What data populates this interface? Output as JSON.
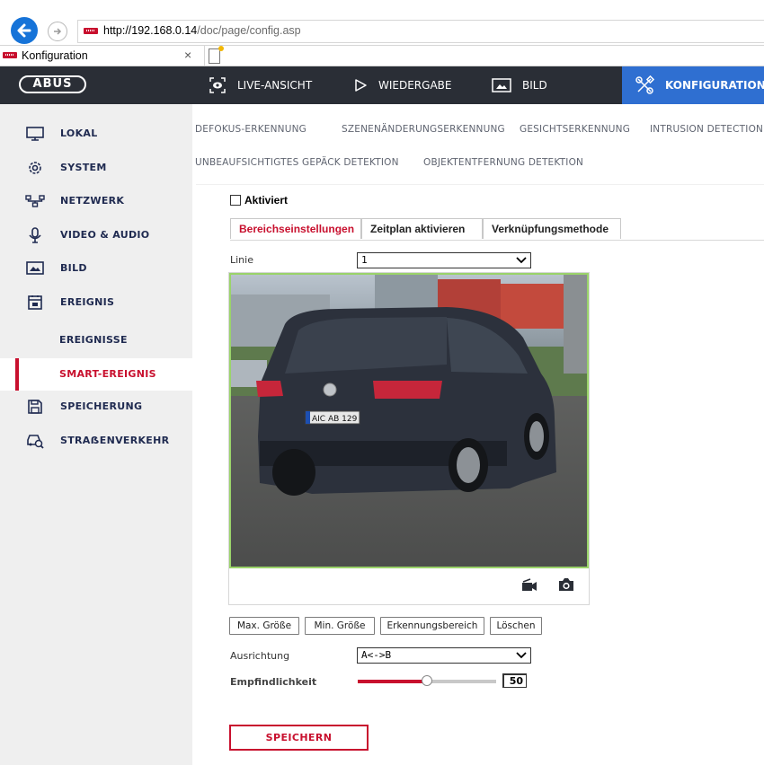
{
  "browser": {
    "url_host": "http://192.168.0.14",
    "url_path": "/doc/page/config.asp",
    "tab_title": "Konfiguration",
    "tab_close": "×"
  },
  "header": {
    "logo": "ABUS",
    "nav": [
      {
        "label": "LIVE-ANSICHT",
        "icon": "eye-camera-icon"
      },
      {
        "label": "WIEDERGABE",
        "icon": "play-icon"
      },
      {
        "label": "BILD",
        "icon": "image-icon"
      },
      {
        "label": "KONFIGURATION",
        "icon": "tools-icon",
        "active": true
      }
    ]
  },
  "sidebar": {
    "items": [
      {
        "label": "LOKAL",
        "icon": "monitor-icon"
      },
      {
        "label": "SYSTEM",
        "icon": "gear-icon"
      },
      {
        "label": "NETZWERK",
        "icon": "network-icon"
      },
      {
        "label": "VIDEO & AUDIO",
        "icon": "microphone-icon"
      },
      {
        "label": "BILD",
        "icon": "image-icon"
      },
      {
        "label": "EREIGNIS",
        "icon": "calendar-icon"
      },
      {
        "label": "EREIGNISSE",
        "sub": true
      },
      {
        "label": "SMART-EREIGNIS",
        "sub": true,
        "active": true
      },
      {
        "label": "SPEICHERUNG",
        "icon": "floppy-icon"
      },
      {
        "label": "STRAẞENVERKEHR",
        "icon": "car-search-icon"
      }
    ]
  },
  "subtabs": {
    "row1": [
      "DEFOKUS-ERKENNUNG",
      "SZENENÄNDERUNGSERKENNUNG",
      "GESICHTSERKENNUNG",
      "INTRUSION DETECTION"
    ],
    "row2": [
      "UNBEAUFSICHTIGTES GEPÄCK DETEKTION",
      "OBJEKTENTFERNUNG DETEKTION"
    ]
  },
  "form": {
    "enabled_label": "Aktiviert",
    "enabled": false,
    "steps": [
      "Bereichseinstellungen",
      "Zeitplan aktivieren",
      "Verknüpfungsmethode"
    ],
    "line_label": "Linie",
    "line_value": "1",
    "buttons": [
      "Max. Größe",
      "Min. Größe",
      "Erkennungsbereich",
      "Löschen"
    ],
    "direction_label": "Ausrichtung",
    "direction_value": "A<->B",
    "sensitivity_label": "Empfindlichkeit",
    "sensitivity_value": "50",
    "sensitivity_fraction": 0.5,
    "save_label": "SPEICHERN"
  },
  "video": {
    "plate_text": "AIC AB 129",
    "icons": [
      "record-icon",
      "camera-snapshot-icon"
    ]
  },
  "colors": {
    "brand_red": "#c8102e",
    "header_bg": "#2a2e36",
    "active_nav": "#2f6fd1",
    "sidebar_bg": "#efefef",
    "roi_border": "#9ad36a"
  }
}
